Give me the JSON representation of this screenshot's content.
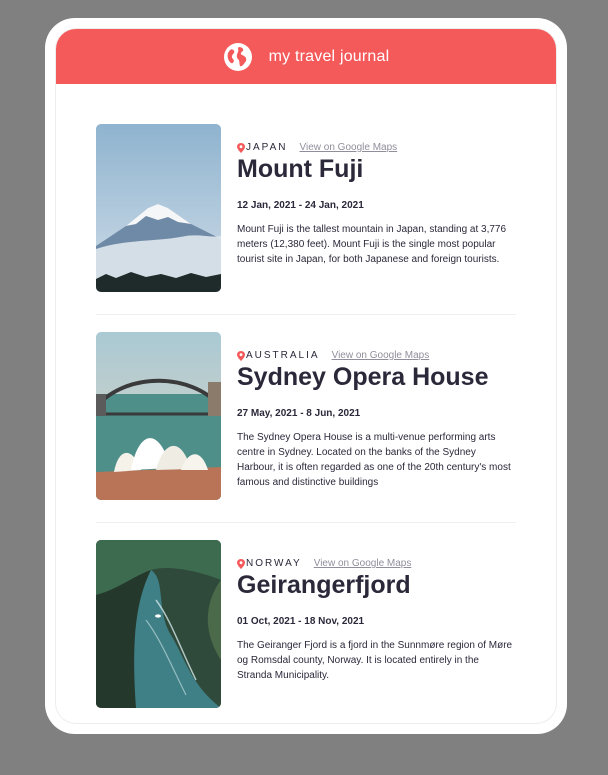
{
  "header": {
    "title": "my travel journal",
    "icon": "globe-icon",
    "color": "#f55a5a"
  },
  "entries": [
    {
      "country": "JAPAN",
      "maps_link": "View on Google Maps",
      "title": "Mount Fuji",
      "dates": "12 Jan, 2021 - 24 Jan, 2021",
      "description": "Mount Fuji is the tallest mountain in Japan, standing at 3,776 meters (12,380 feet). Mount Fuji is the single most popular tourist site in Japan, for both Japanese and foreign tourists."
    },
    {
      "country": "AUSTRALIA",
      "maps_link": "View on Google Maps",
      "title": "Sydney Opera House",
      "dates": "27 May, 2021 - 8 Jun, 2021",
      "description": "The Sydney Opera House is a multi-venue performing arts centre in Sydney. Located on the banks of the Sydney Harbour, it is often regarded as one of the 20th century's most famous and distinctive buildings"
    },
    {
      "country": "NORWAY",
      "maps_link": "View on Google Maps",
      "title": "Geirangerfjord",
      "dates": "01 Oct, 2021 - 18 Nov, 2021",
      "description": "The Geiranger Fjord is a fjord in the Sunnmøre region of Møre og Romsdal county, Norway. It is located entirely in the Stranda Municipality."
    }
  ]
}
